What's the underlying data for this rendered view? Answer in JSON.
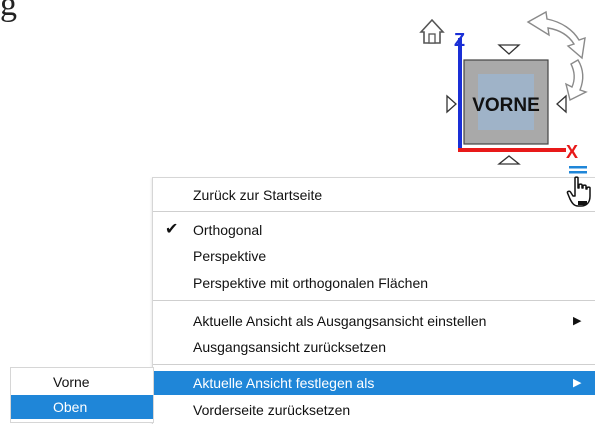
{
  "heading_fragment": "g",
  "viewcube": {
    "face_label": "VORNE",
    "axis_z": "Z",
    "axis_x": "X",
    "colors": {
      "z_axis": "#1a2fd6",
      "x_axis": "#e81919",
      "face": "#a9a9a9",
      "face_inner": "#9fb3c8"
    },
    "icons": [
      "home-icon",
      "rotate-arrow-icon",
      "nav-arrow-up-icon",
      "nav-arrow-down-icon",
      "nav-arrow-left-icon",
      "nav-arrow-right-icon",
      "menu-icon",
      "hand-cursor-icon"
    ]
  },
  "context_menu": {
    "items": [
      {
        "label": "Zurück zur Startseite"
      },
      {
        "label": "Orthogonal",
        "checked": true
      },
      {
        "label": "Perspektive"
      },
      {
        "label": "Perspektive mit orthogonalen Flächen"
      },
      {
        "label": "Aktuelle Ansicht als Ausgangsansicht einstellen",
        "submenu_arrow": "▶"
      },
      {
        "label": "Ausgangsansicht zurücksetzen"
      },
      {
        "label": "Aktuelle Ansicht festlegen als",
        "submenu_arrow": "▶",
        "highlighted": true
      },
      {
        "label": "Vorderseite zurücksetzen"
      }
    ],
    "check_glyph": "✔"
  },
  "submenu": {
    "items": [
      {
        "label": "Vorne"
      },
      {
        "label": "Oben",
        "highlighted": true
      }
    ]
  },
  "accent_color": "#1f86d8"
}
